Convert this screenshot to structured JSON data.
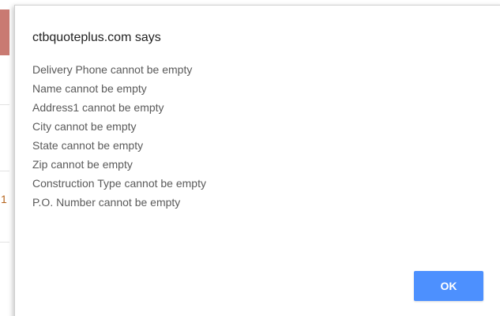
{
  "background": {
    "partial_glyph": "1"
  },
  "dialog": {
    "title": "ctbquoteplus.com says",
    "messages": [
      "Delivery Phone cannot be empty",
      "Name cannot be empty",
      "Address1 cannot be empty",
      "City cannot be empty",
      "State cannot be empty",
      "Zip cannot be empty",
      "Construction Type cannot be empty",
      "P.O. Number cannot be empty"
    ],
    "ok_label": "OK"
  },
  "colors": {
    "button_accent": "#4d90fe",
    "message_text": "#5a5a5a",
    "title_text": "#222222",
    "background_band": "#c97a72"
  }
}
